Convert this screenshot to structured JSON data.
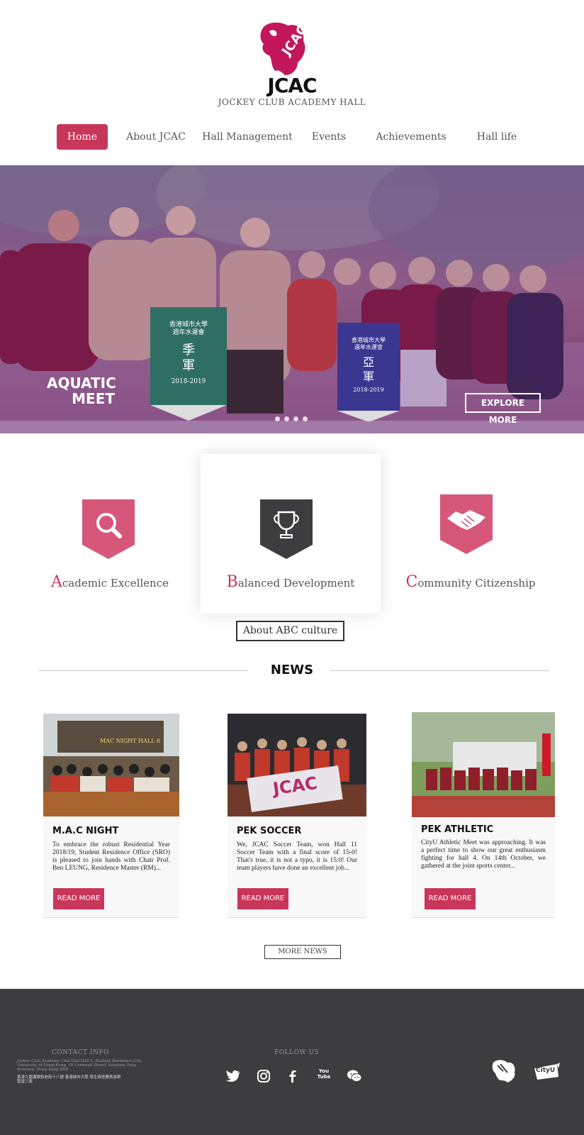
{
  "header": {
    "logo_text": "JCAC",
    "logo_subtitle": "JOCKEY CLUB ACADEMY HALL",
    "brand_color": "#c8365a",
    "nav": [
      {
        "label": "Home",
        "active": true
      },
      {
        "label": "About JCAC",
        "active": false
      },
      {
        "label": "Hall Management",
        "active": false
      },
      {
        "label": "Events",
        "active": false
      },
      {
        "label": "Achievements",
        "active": false
      },
      {
        "label": "Hall life",
        "active": false
      }
    ]
  },
  "hero": {
    "title_line1": "AQUATIC",
    "title_line2": "MEET",
    "explore_label": "EXPLORE MORE",
    "banner_left": {
      "line1": "香港城市大學",
      "line2": "週年水運會",
      "line3": "季",
      "line4": "軍",
      "year": "2018-2019"
    },
    "banner_right": {
      "line1": "香港城市大學",
      "line2": "週年水運會",
      "line3": "亞",
      "line4": "軍",
      "year": "2018-2019"
    },
    "slide_count": 4,
    "active_slide": 1
  },
  "pillars": [
    {
      "cap": "A",
      "rest": "cademic Excellence",
      "icon": "search-icon"
    },
    {
      "cap": "B",
      "rest": "alanced Development",
      "icon": "trophy-icon"
    },
    {
      "cap": "C",
      "rest": "ommunity Citizenship",
      "icon": "handshake-icon"
    }
  ],
  "abc_button": "About ABC culture",
  "news": {
    "title": "NEWS",
    "cards": [
      {
        "title": "M.A.C NIGHT",
        "text": "To embrace the robust Residential Year 2018/19, Student Residence Office (SRO) is pleased to join hands with Chair Prof. Ben LEUNG, Residence Master (RM)...",
        "button": "READ MORE",
        "image_text": "MAC NIGHT HALL 6"
      },
      {
        "title": "PEK SOCCER",
        "text": "We, JCAC Soccer Team, won Hall 11 Soccer Team with a final score of 15-0! That's true, it is not a typo, it is 15:0! Our team players have done an excellent job...",
        "button": "READ MORE",
        "image_text": "JCAC"
      },
      {
        "title": "PEK ATHLETIC",
        "text": "CityU Athletic Meet was approaching. It was a perfect time to show our great enthusiasm fighting for hall 4. On 14th October, we gathered at the joint sports center...",
        "button": "READ MORE",
        "image_text": ""
      }
    ],
    "more_label": "MORE NEWS"
  },
  "footer": {
    "contact_heading": "CONTACT INFO",
    "address_en": "Jockey Club Academy Chai Hall Hall 4, Student Residence,City University of Hong Kong, 18 Cornwall Street, Kowloon Tong Kowloon, Hong Kong SAR",
    "address_zh": "香港九龍塘歌和老街十八號 香港城市大學 學生宿舍賽馬會群智堂二座",
    "follow_heading": "FOLLOW US",
    "social_icons": [
      "twitter-icon",
      "instagram-icon",
      "facebook-icon",
      "youtube-icon",
      "wechat-icon"
    ],
    "youtube_text": "You Tube",
    "cityu_logo_text": "CityU"
  }
}
